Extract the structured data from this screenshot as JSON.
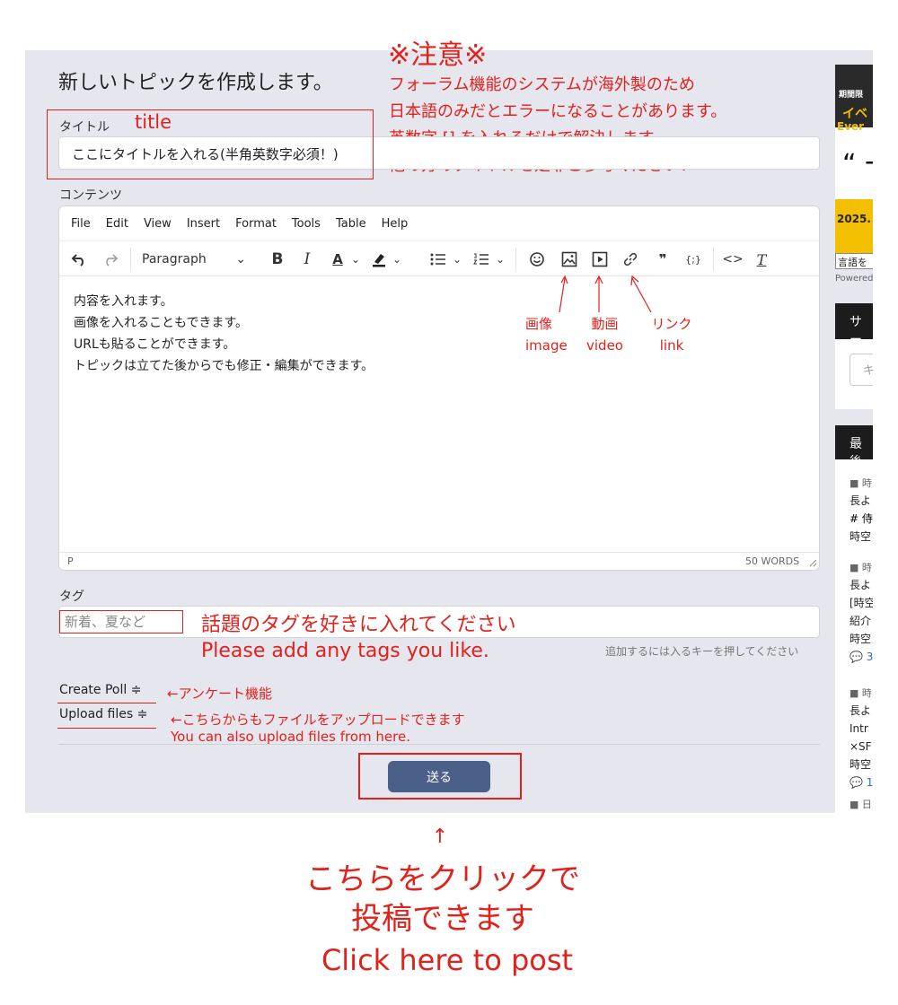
{
  "page": {
    "heading": "新しいトピックを作成します。",
    "title_label": "タイトル",
    "title_value": "ここにタイトルを入れる(半角英数字必須！)",
    "content_label": "コンテンツ",
    "tags_label": "タグ",
    "tags_placeholder": "新着、夏など",
    "tags_hint": "追加するには入るキーを押してください",
    "create_poll": "Create Poll",
    "upload_files": "Upload files",
    "submit": "送る",
    "toggle_icon": "≑"
  },
  "editor": {
    "menu": [
      "File",
      "Edit",
      "View",
      "Insert",
      "Format",
      "Tools",
      "Table",
      "Help"
    ],
    "block_format": "Paragraph",
    "toolbar_icons": [
      "undo-icon",
      "redo-icon",
      "bold-icon",
      "italic-icon",
      "text-color-icon",
      "highlight-icon",
      "bullet-list-icon",
      "numbered-list-icon",
      "emoji-icon",
      "image-icon",
      "video-icon",
      "link-icon",
      "quote-icon",
      "code-sample-icon",
      "source-code-icon",
      "clear-format-icon"
    ],
    "bold": "B",
    "italic": "I",
    "font_color": "A",
    "chevron": "⌄",
    "quote": "❞",
    "code_sample": "{;}",
    "source_code": "<>",
    "clear_format": "T",
    "content_lines": [
      "内容を入れます。",
      "画像を入れることもできます。",
      "URLも貼ることができます。",
      "トピックは立てた後からでも修正・編集ができます。"
    ],
    "status_path": "P",
    "word_count": "50 WORDS"
  },
  "annotations": {
    "warning_title": "※注意※",
    "warning_lines": [
      "フォーラム機能のシステムが海外製のため",
      "日本語のみだとエラーになることがあります。",
      "英数字 [] を入れるだけで解決します。",
      "他の方のタイトルを是非ご参考ください！"
    ],
    "title_note": "title",
    "image_jp": "画像",
    "image_en": "image",
    "video_jp": "動画",
    "video_en": "video",
    "link_jp": "リンク",
    "link_en": "link",
    "arrow_up": "↑",
    "tags_jp": "話題のタグを好きに入れてください",
    "tags_en": "Please add any tags you like.",
    "poll_note": "←アンケート機能",
    "upload_note_jp": "←こちらからもファイルをアップロードできます",
    "upload_note_en": "You can also upload files from here.",
    "click_arrow": "↑",
    "click_jp_1": "こちらをクリックで",
    "click_jp_2": "投稿できます",
    "click_en": "Click here to post"
  },
  "sidebar": {
    "banner_line1": "期間限",
    "banner_line2": "イベ",
    "banner_line3": "Ever",
    "banner_quote": "“ 一",
    "banner_date": "2025.",
    "lang_select": "言語を",
    "powered": "Powered",
    "search_header": "サー",
    "search_placeholder": "キ",
    "latest_header": "最後",
    "items": [
      {
        "meta": "■ 時",
        "l1": "長よ",
        "l2": "# 侍",
        "l3": "時空"
      },
      {
        "meta": "■ 時",
        "l1": "長よ",
        "l2": "[時空",
        "l3": "紹介",
        "l4": "時空",
        "l5": "💬 3"
      },
      {
        "meta": "■ 時",
        "l1": "長よ",
        "l2": "Intr",
        "l3": "×SF",
        "l4": "時空",
        "l5": "💬 1"
      },
      {
        "meta": "■ 日"
      }
    ]
  },
  "colors": {
    "annotation_red": "#e0211c",
    "panel_bg": "#e6e6ee",
    "submit_bg": "#4a6089"
  }
}
